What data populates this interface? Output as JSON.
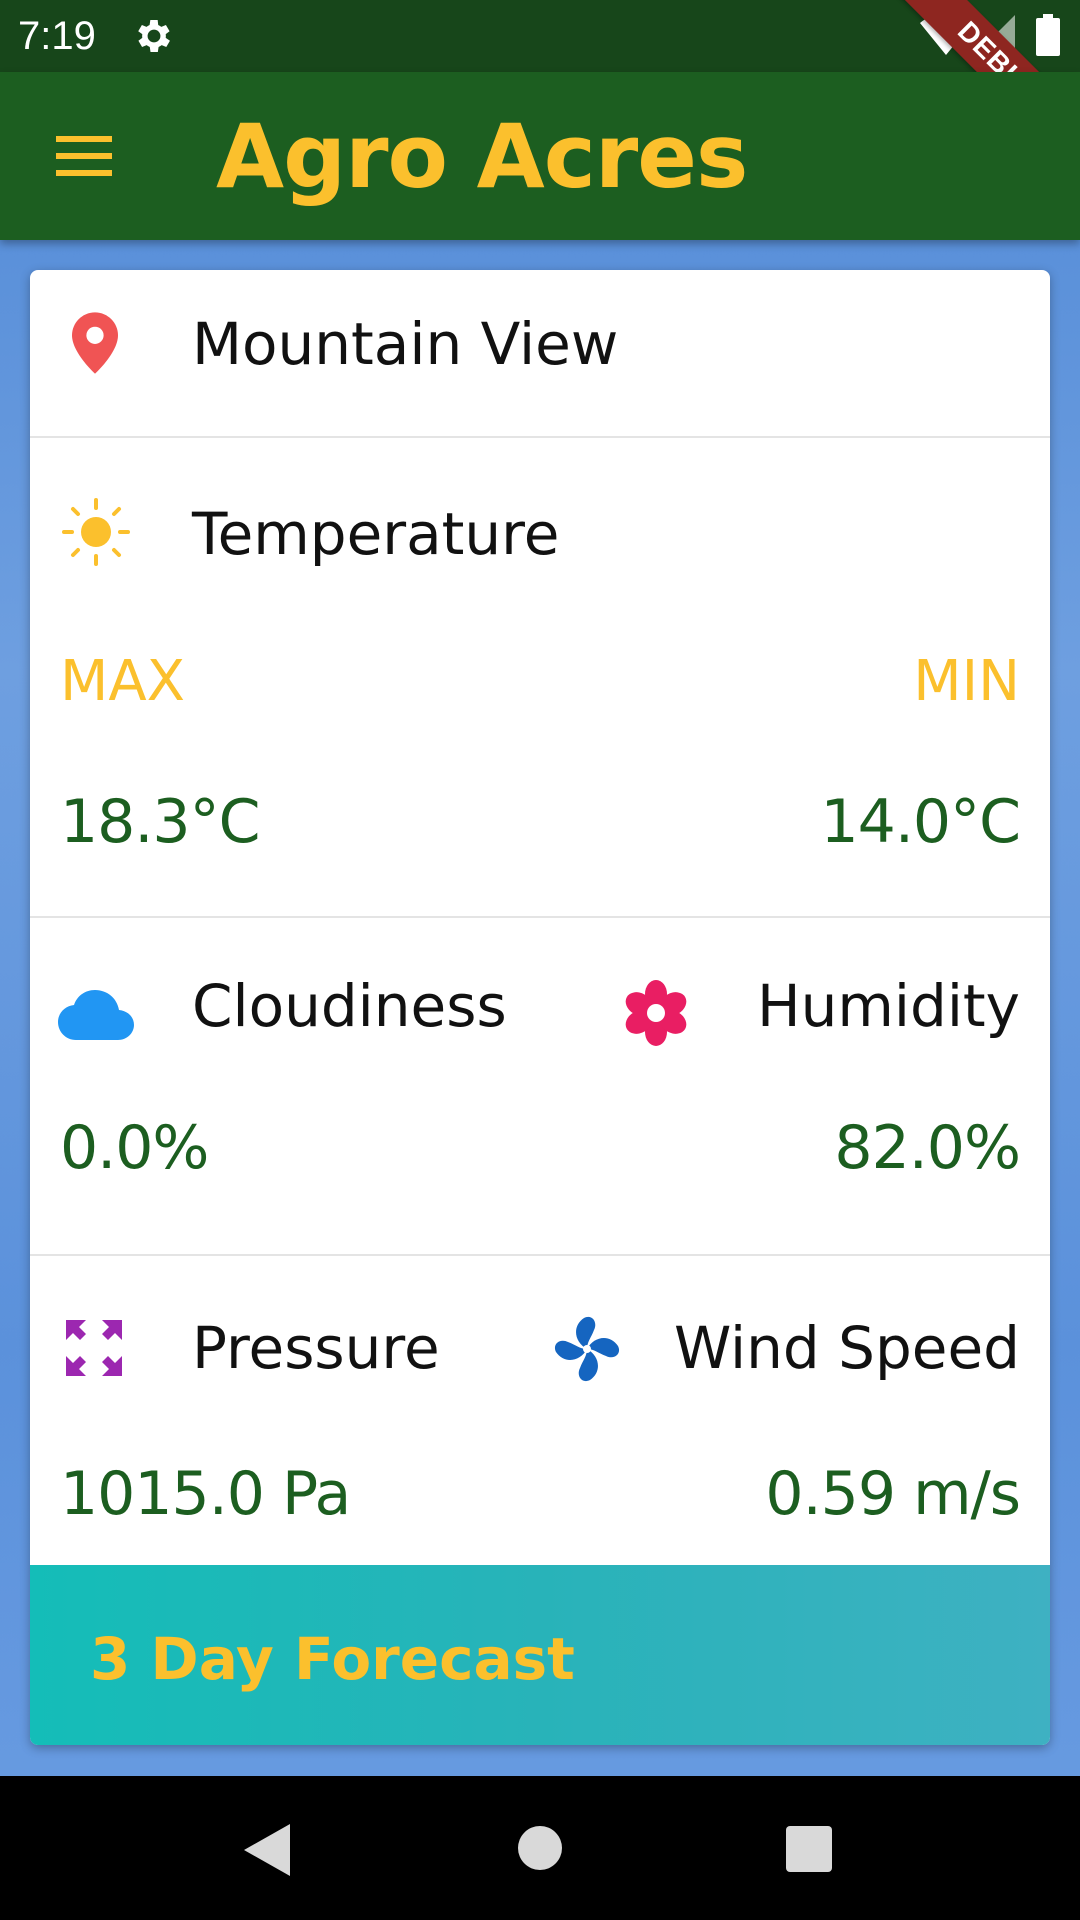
{
  "status_bar": {
    "time": "7:19",
    "debug_label": "DEBUG",
    "icons": [
      "gear-icon",
      "wifi-icon",
      "signal-icon",
      "battery-icon"
    ]
  },
  "app_bar": {
    "title": "Agro Acres",
    "menu_icon": "menu-icon"
  },
  "location": {
    "icon": "location-pin-icon",
    "name": "Mountain View"
  },
  "temperature": {
    "icon": "sun-icon",
    "label": "Temperature",
    "max_label": "MAX",
    "min_label": "MIN",
    "max_value": "18.3°C",
    "min_value": "14.0°C"
  },
  "cloudiness": {
    "icon": "cloud-icon",
    "label": "Cloudiness",
    "value": "0.0%"
  },
  "humidity": {
    "icon": "flower-icon",
    "label": "Humidity",
    "value": "82.0%"
  },
  "pressure": {
    "icon": "expand-arrows-icon",
    "label": "Pressure",
    "value": "1015.0 Pa"
  },
  "wind": {
    "icon": "fan-icon",
    "label": "Wind Speed",
    "value": "0.59 m/s"
  },
  "forecast": {
    "label": "3 Day Forecast"
  },
  "nav_bar": {
    "icons": [
      "back-icon",
      "home-icon",
      "recents-icon"
    ]
  },
  "colors": {
    "app_bar": "#1c5e20",
    "status_bar": "#17461a",
    "accent_yellow": "#fbc02d",
    "value_green": "#1c5e20",
    "pin_red": "#f05454",
    "cloud_blue": "#2196f3",
    "flower_pink": "#e91e63",
    "pressure_purple": "#9c27b0",
    "fan_blue": "#1565c0",
    "forecast_teal": "#14bdb8"
  }
}
